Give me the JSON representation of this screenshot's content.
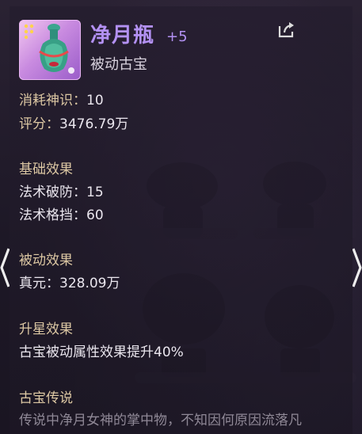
{
  "item": {
    "name": "净月瓶",
    "level": "+5",
    "type": "被动古宝"
  },
  "stats": {
    "cost_label": "消耗神识：",
    "cost_value": "10",
    "score_label": "评分：",
    "score_value": "3476.79万"
  },
  "sections": {
    "base_title": "基础效果",
    "base": [
      {
        "label": "法术破防：",
        "value": "15"
      },
      {
        "label": "法术格挡：",
        "value": "60"
      }
    ],
    "passive_title": "被动效果",
    "passive": [
      {
        "label": "真元：",
        "value": "328.09万"
      }
    ],
    "star_title": "升星效果",
    "star_text": "古宝被动属性效果提升40%",
    "lore_title": "古宝传说",
    "lore_text": "传说中净月女神的掌中物，不知因何原因流落凡"
  },
  "icons": {
    "share": "share-icon",
    "prev": "chevron-left-icon",
    "next": "chevron-right-icon",
    "item": "jade-vase-icon"
  },
  "colors": {
    "title": "#b391f3",
    "label": "#dcc7a3",
    "text": "#eae6ee",
    "lore": "#8f8896"
  }
}
